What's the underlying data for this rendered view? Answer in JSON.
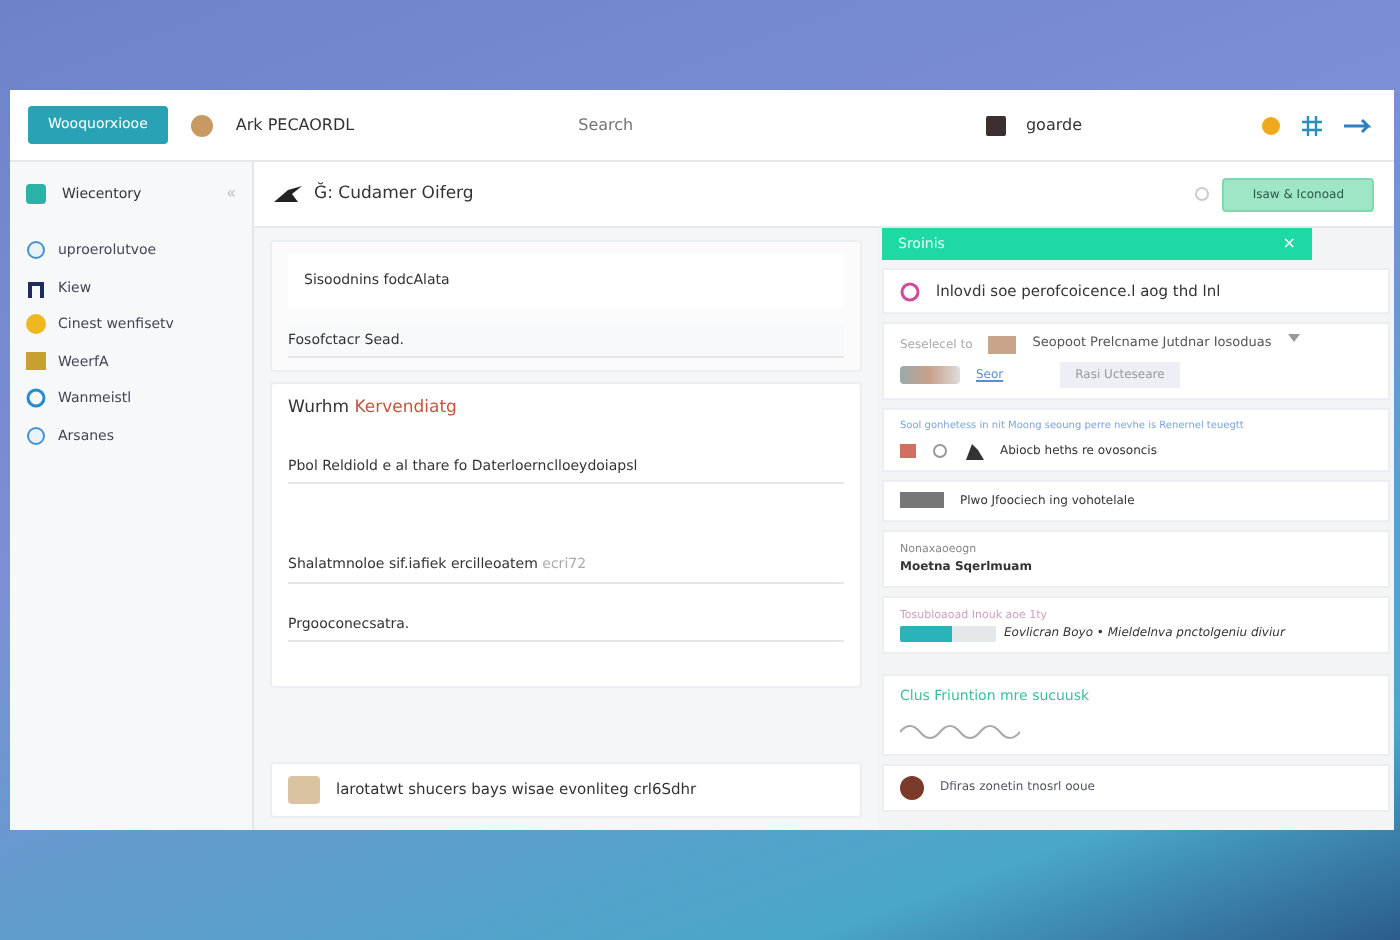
{
  "topbar": {
    "brand_button": "Wooquorxiooe",
    "account": "Ark PECAORDL",
    "search": {
      "placeholder": "Search"
    },
    "user": "goarde"
  },
  "sidebar": {
    "title": "Wiecentory",
    "collapse": "«",
    "items": [
      {
        "label": "uproerolutvoe",
        "selected": false
      },
      {
        "label": "Kiew",
        "selected": false
      },
      {
        "label": "Cinest wenfisetv",
        "selected": false
      },
      {
        "label": "WeerfA",
        "selected": false
      },
      {
        "label": "Wanmeistl",
        "selected": false
      },
      {
        "label": "Arsanes",
        "selected": false
      }
    ]
  },
  "header": {
    "title": "Ğ: Cudamer Oiferg",
    "action_button": "Isaw & Iconoad"
  },
  "form": {
    "card_title": "Sisoodnins fodcAlata",
    "field_1": "Fosofctacr Sead.",
    "heading": {
      "text": "Wurhm",
      "accent": "Kervendiatg"
    },
    "field_2": "Pbol Reldiold e al thare fo Daterloernclloeydoiapsl",
    "field_3": {
      "value": "Shalatmnoloe sif.iafiek ercilleoatem",
      "hint": "ecri72"
    },
    "field_4": "Prgooconecsatra.",
    "footer": "larotatwt shucers bays wisae evonliteg crl6Sdhr"
  },
  "panel": {
    "title": "Sroinis",
    "close": "×",
    "intro": "lnlovdi soe perofcoicence.l aog thd lnl",
    "select": {
      "label": "Seselecel to",
      "value": "Seopoot Prelcname Jutdnar Iosoduas",
      "link": "Seor",
      "button": "Rasi Ucteseare"
    },
    "note": {
      "text": "Sool gonhetess in nit Moong seoung perre nevhe is Renernel teuegtt",
      "item": "Abiocb heths re ovosoncis"
    },
    "attachment": "Plwo Jfoociech ing vohotelale",
    "info": {
      "label": "Nonaxaoeogn",
      "value": "Moetna Sqerlmuam"
    },
    "progress": {
      "label": "Tosubloaoad Inouk aoe 1ty",
      "level": 0.55,
      "text": "Eovlicran Boyo • Mieldelnva pnctolgeniu diviur"
    },
    "summary": {
      "title": "Clus Friuntion mre sucuusk"
    },
    "comment": "Dfiras zonetin tnosrl ooue"
  }
}
